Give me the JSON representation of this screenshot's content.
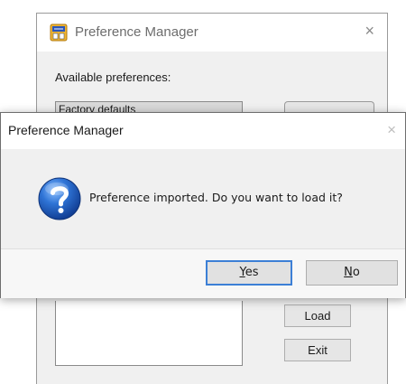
{
  "background_window": {
    "title": "Preference Manager",
    "close_glyph": "×",
    "app_icon": "preference-manager-app-icon",
    "available_label": "Available preferences:",
    "selected_preference": "Factory defaults",
    "load_label": "Load",
    "exit_label": "Exit"
  },
  "dialog": {
    "title": "Preference Manager",
    "close_glyph": "×",
    "icon": "question-icon",
    "message": "Preference imported. Do you want to load it?",
    "yes_mnemonic": "Y",
    "yes_rest": "es",
    "no_mnemonic": "N",
    "no_rest": "o"
  },
  "colors": {
    "dialog_body": "#f0f0f0",
    "titlebar": "#ffffff",
    "default_button_border": "#3c7fd6",
    "question_icon_blue": "#1f5fbf"
  }
}
